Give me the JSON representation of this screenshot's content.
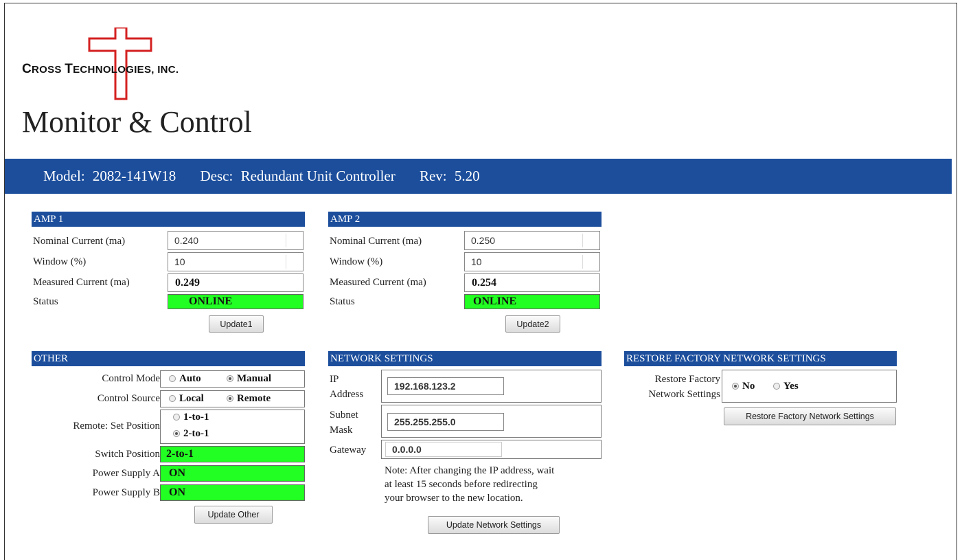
{
  "company": {
    "name_part1_big": "C",
    "name_part1": "ROSS ",
    "name_part2_big": "T",
    "name_part2": "ECHNOLOGIES, INC."
  },
  "page_title": "Monitor & Control",
  "infobar": {
    "model_label": "Model:",
    "model_value": "2082-141W18",
    "desc_label": "Desc:",
    "desc_value": "Redundant Unit Controller",
    "rev_label": "Rev:",
    "rev_value": "5.20"
  },
  "amp1": {
    "header": "AMP 1",
    "nominal_label": "Nominal Current (ma)",
    "nominal_value": "0.240",
    "window_label": "Window (%)",
    "window_value": "10",
    "measured_label": "Measured Current (ma)",
    "measured_value": "0.249",
    "status_label": "Status",
    "status_value": "ONLINE",
    "button": "Update1"
  },
  "amp2": {
    "header": "AMP 2",
    "nominal_label": "Nominal Current (ma)",
    "nominal_value": "0.250",
    "window_label": "Window (%)",
    "window_value": "10",
    "measured_label": "Measured Current (ma)",
    "measured_value": "0.254",
    "status_label": "Status",
    "status_value": "ONLINE",
    "button": "Update2"
  },
  "other": {
    "header": "OTHER",
    "control_mode_label": "Control Mode",
    "control_mode_auto": "Auto",
    "control_mode_manual": "Manual",
    "control_mode_selected": "Manual",
    "control_source_label": "Control Source",
    "control_source_local": "Local",
    "control_source_remote": "Remote",
    "control_source_selected": "Remote",
    "set_position_label": "Remote: Set Position",
    "set_position_opt1": "1-to-1",
    "set_position_opt2": "2-to-1",
    "set_position_selected": "2-to-1",
    "switch_position_label": "Switch Position",
    "switch_position_value": "2-to-1",
    "psa_label": "Power Supply A",
    "psa_value": "ON",
    "psb_label": "Power Supply B",
    "psb_value": "ON",
    "button": "Update Other"
  },
  "network": {
    "header": "NETWORK SETTINGS",
    "ip_label_1": "IP",
    "ip_label_2": "Address",
    "ip_value": "192.168.123.2",
    "subnet_label_1": "Subnet",
    "subnet_label_2": "Mask",
    "subnet_value": "255.255.255.0",
    "gateway_label": "Gateway",
    "gateway_value": "0.0.0.0",
    "note_line1": "Note: After changing the IP address, wait",
    "note_line2": "at least 15 seconds before redirecting",
    "note_line3": "your browser to the new location.",
    "button": "Update Network Settings"
  },
  "restore": {
    "header": "RESTORE FACTORY NETWORK SETTINGS",
    "label_line1": "Restore Factory",
    "label_line2": "Network Settings",
    "opt_no": "No",
    "opt_yes": "Yes",
    "selected": "No",
    "button": "Restore Factory Network Settings"
  },
  "colors": {
    "header_blue": "#1c4e9c",
    "status_green": "#22ff22",
    "logo_red": "#d42020"
  }
}
